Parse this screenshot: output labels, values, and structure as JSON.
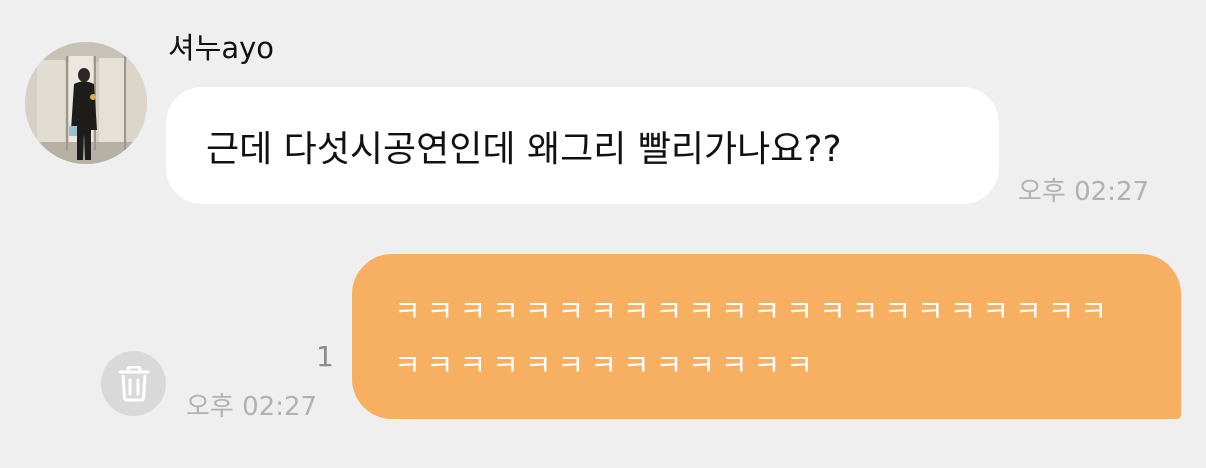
{
  "incoming": {
    "sender": "셔누ayo",
    "message": "근데 다섯시공연인데 왜그리 빨리가나요??",
    "time": "오후 02:27"
  },
  "outgoing": {
    "message": "ㅋㅋㅋㅋㅋㅋㅋㅋㅋㅋㅋㅋㅋㅋㅋㅋㅋㅋㅋㅋㅋㅋㅋㅋㅋㅋㅋㅋㅋㅋㅋㅋㅋㅋㅋ",
    "read_count": "1",
    "time": "오후 02:27"
  },
  "icons": {
    "delete": "trash-icon"
  },
  "colors": {
    "background": "#efefef",
    "incoming_bubble": "#ffffff",
    "outgoing_bubble": "#f7b062",
    "timestamp": "#b1b1b1"
  }
}
